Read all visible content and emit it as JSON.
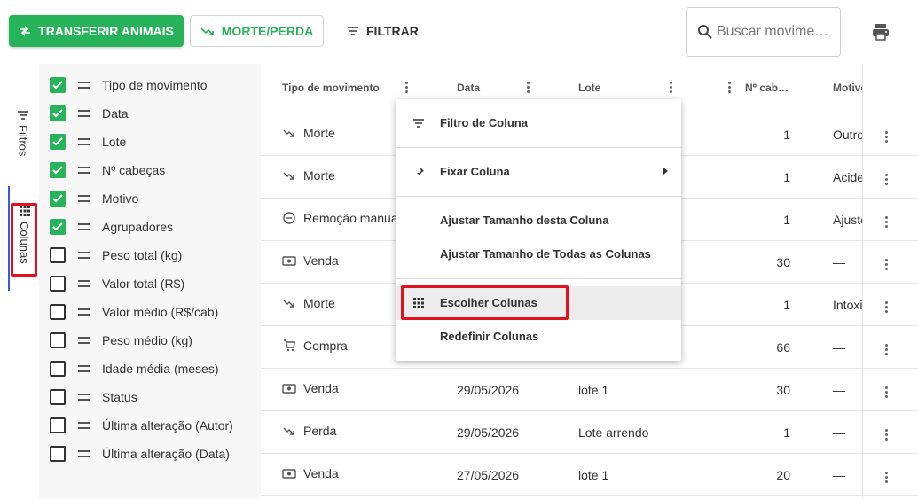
{
  "toolbar": {
    "transfer_label": "TRANSFERIR ANIMAIS",
    "death_label": "MORTE/PERDA",
    "filter_label": "FILTRAR",
    "search_placeholder": "Buscar movime…"
  },
  "side_tabs": {
    "filtros": "Filtros",
    "colunas": "Colunas"
  },
  "columns_panel": {
    "items": [
      {
        "label": "Tipo de movimento",
        "checked": true
      },
      {
        "label": "Data",
        "checked": true
      },
      {
        "label": "Lote",
        "checked": true
      },
      {
        "label": "Nº cabeças",
        "checked": true
      },
      {
        "label": "Motivo",
        "checked": true
      },
      {
        "label": "Agrupadores",
        "checked": true
      },
      {
        "label": "Peso total (kg)",
        "checked": false
      },
      {
        "label": "Valor total (R$)",
        "checked": false
      },
      {
        "label": "Valor médio (R$/cab)",
        "checked": false
      },
      {
        "label": "Peso médio (kg)",
        "checked": false
      },
      {
        "label": "Idade média (meses)",
        "checked": false
      },
      {
        "label": "Status",
        "checked": false
      },
      {
        "label": "Última alteração (Autor)",
        "checked": false
      },
      {
        "label": "Última alteração (Data)",
        "checked": false
      }
    ]
  },
  "grid": {
    "headers": {
      "tipo": "Tipo de movimento",
      "data": "Data",
      "lote": "Lote",
      "cabecas": "Nº cab…",
      "motivo": "Motivo"
    },
    "rows": [
      {
        "tipo": "Morte",
        "icon": "trend-down-icon",
        "data": "",
        "lote": "",
        "cab": "1",
        "motivo": "Outro"
      },
      {
        "tipo": "Morte",
        "icon": "trend-down-icon",
        "data": "",
        "lote": "",
        "cab": "1",
        "motivo": "Acide"
      },
      {
        "tipo": "Remoção manual",
        "icon": "minus-circle-icon",
        "data": "",
        "lote": "",
        "cab": "1",
        "motivo": "Ajuste"
      },
      {
        "tipo": "Venda",
        "icon": "cash-icon",
        "data": "",
        "lote": "",
        "cab": "30",
        "motivo": "—"
      },
      {
        "tipo": "Morte",
        "icon": "trend-down-icon",
        "data": "",
        "lote": "",
        "cab": "1",
        "motivo": "Intoxi"
      },
      {
        "tipo": "Compra",
        "icon": "cart-icon",
        "data": "",
        "lote": "",
        "cab": "66",
        "motivo": "—"
      },
      {
        "tipo": "Venda",
        "icon": "cash-icon",
        "data": "29/05/2026",
        "lote": "lote 1",
        "cab": "30",
        "motivo": "—"
      },
      {
        "tipo": "Perda",
        "icon": "trend-down-icon",
        "data": "29/05/2026",
        "lote": "Lote arrendo",
        "cab": "1",
        "motivo": "—"
      },
      {
        "tipo": "Venda",
        "icon": "cash-icon",
        "data": "27/05/2026",
        "lote": "lote 1",
        "cab": "20",
        "motivo": "—"
      }
    ]
  },
  "context_menu": {
    "filtro_coluna": "Filtro de Coluna",
    "fixar_coluna": "Fixar Coluna",
    "ajustar_coluna": "Ajustar Tamanho desta Coluna",
    "ajustar_todas": "Ajustar Tamanho de Todas as Colunas",
    "escolher_colunas": "Escolher Colunas",
    "redefinir_colunas": "Redefinir Colunas"
  },
  "colors": {
    "primary": "#27b35a",
    "highlight_box": "#e0121f",
    "active_tab": "#3a5fc8"
  }
}
